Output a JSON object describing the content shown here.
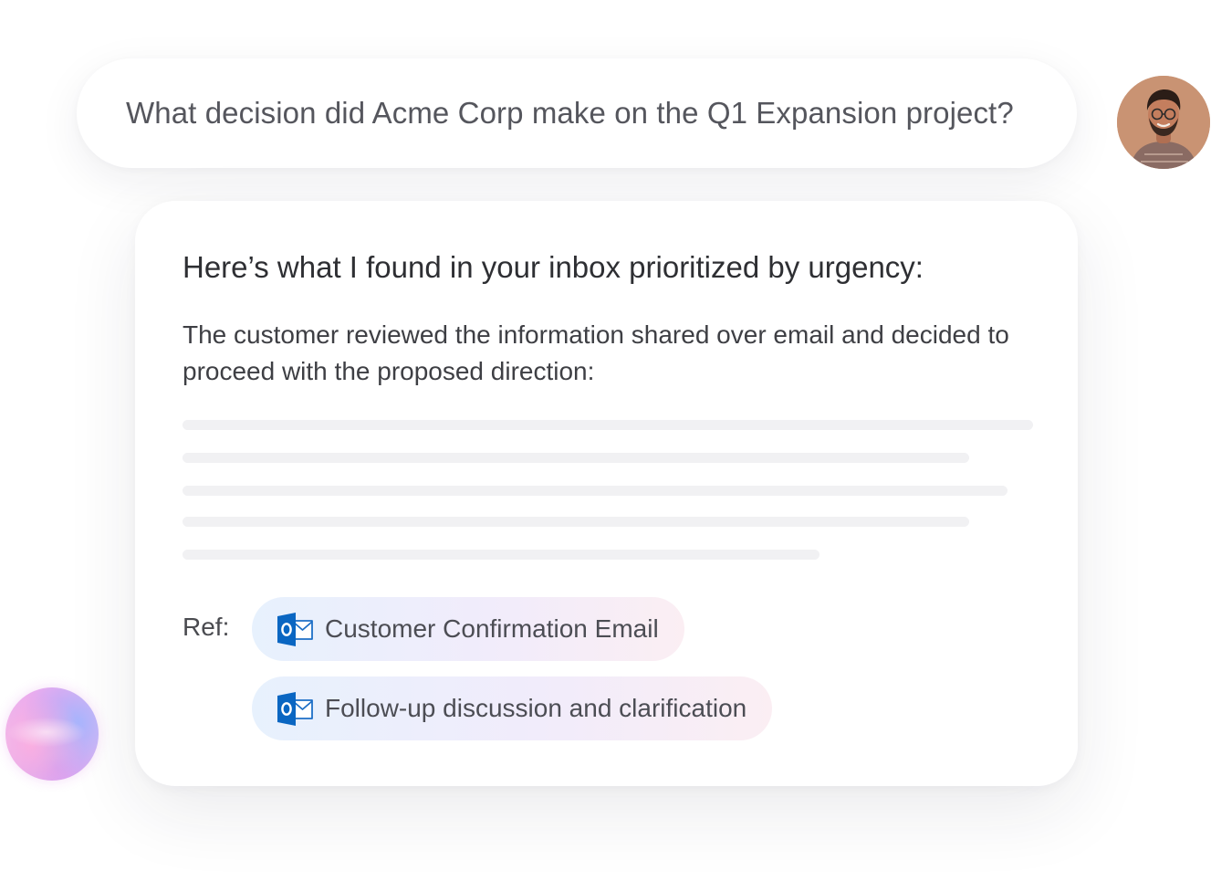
{
  "question": {
    "text": "What decision did Acme Corp make on the Q1 Expansion project?"
  },
  "answer": {
    "heading": "Here’s what I found in your inbox prioritized by urgency:",
    "body": "The customer reviewed the information shared over email and decided to proceed with the proposed direction:",
    "ref_label": "Ref:",
    "references": [
      {
        "label": "Customer Confirmation Email",
        "icon": "outlook-icon"
      },
      {
        "label": "Follow-up discussion and clarification",
        "icon": "outlook-icon"
      }
    ]
  },
  "icons": {
    "user_avatar": "user-avatar-photo",
    "assistant": "assistant-orb"
  },
  "colors": {
    "outlook_blue": "#0a66c2",
    "chip_gradient_start": "#e7f1fd",
    "chip_gradient_end": "#fbeef3",
    "skeleton": "#f1f1f3"
  }
}
